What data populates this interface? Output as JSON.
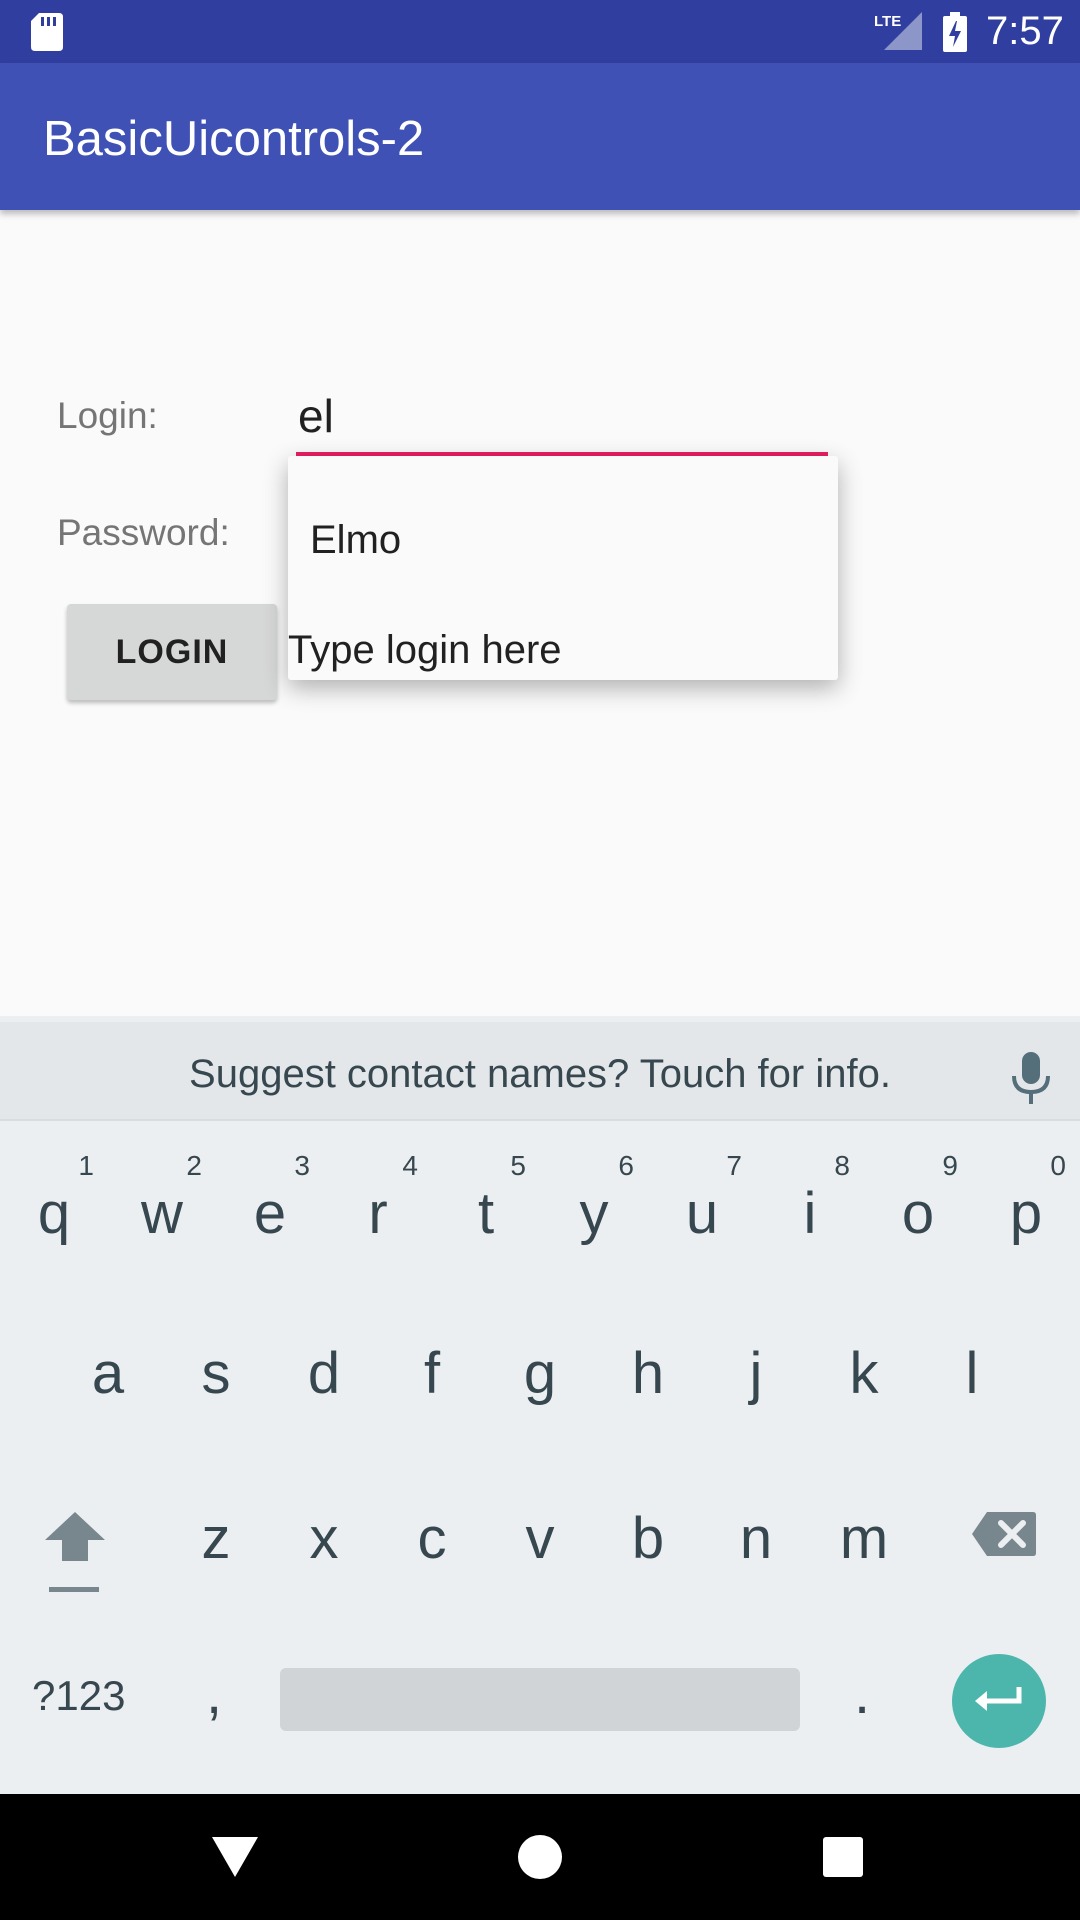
{
  "status_bar": {
    "time": "7:57",
    "network": "LTE"
  },
  "app_bar": {
    "title": "BasicUicontrols-2"
  },
  "form": {
    "login_label": "Login:",
    "password_label": "Password:",
    "login_value": "el",
    "login_button": "LOGIN"
  },
  "autocomplete": {
    "suggestions": [
      "Elmo"
    ],
    "hint": "Type login here"
  },
  "keyboard": {
    "suggestion_text": "Suggest contact names? Touch for info.",
    "row1": [
      "q",
      "w",
      "e",
      "r",
      "t",
      "y",
      "u",
      "i",
      "o",
      "p"
    ],
    "row1_numbers": [
      "1",
      "2",
      "3",
      "4",
      "5",
      "6",
      "7",
      "8",
      "9",
      "0"
    ],
    "row2": [
      "a",
      "s",
      "d",
      "f",
      "g",
      "h",
      "j",
      "k",
      "l"
    ],
    "row3": [
      "z",
      "x",
      "c",
      "v",
      "b",
      "n",
      "m"
    ],
    "symbols_key": "?123",
    "comma_key": ",",
    "period_key": "."
  },
  "colors": {
    "status_bar": "#303f9f",
    "app_bar": "#3f51b5",
    "accent": "#e91e63",
    "enter_key": "#4db6ac"
  }
}
